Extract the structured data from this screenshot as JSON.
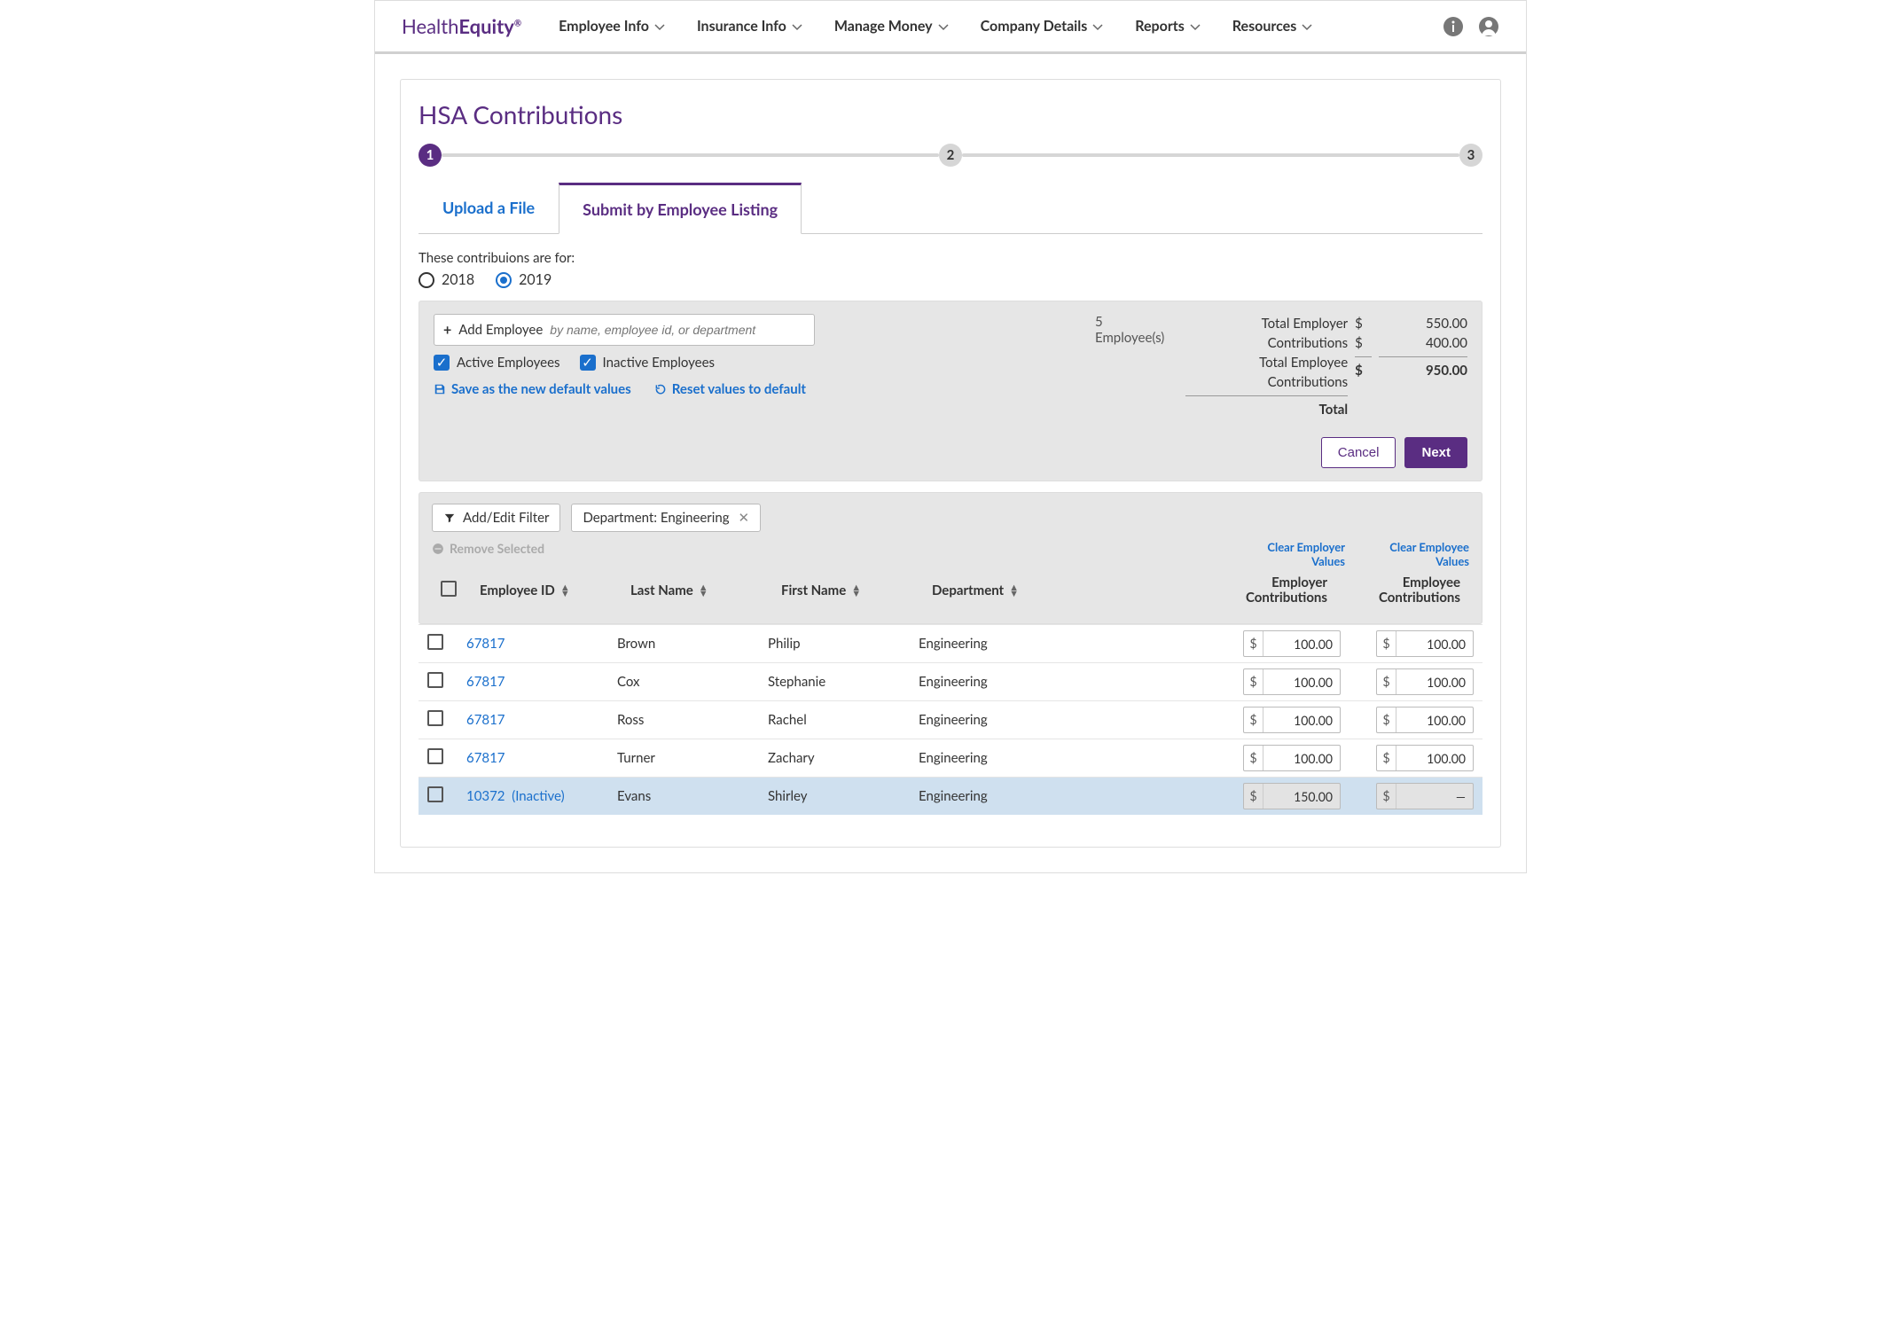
{
  "brand": {
    "word1": "Health",
    "word2": "Equity"
  },
  "nav": {
    "items": [
      "Employee Info",
      "Insurance Info",
      "Manage Money",
      "Company Details",
      "Reports",
      "Resources"
    ]
  },
  "page": {
    "title": "HSA Contributions"
  },
  "stepper": {
    "s1": "1",
    "s2": "2",
    "s3": "3"
  },
  "tabs": {
    "upload": "Upload a File",
    "listing": "Submit by Employee Listing"
  },
  "yearSection": {
    "label": "These contribuions are for:",
    "y1": "2018",
    "y2": "2019"
  },
  "addEmp": {
    "plus": "+",
    "label": "Add Employee",
    "placeholder": "by name, employee id, or department"
  },
  "checks": {
    "active": "Active Employees",
    "inactive": "Inactive Employees"
  },
  "links": {
    "save": "Save as the new default values",
    "reset": "Reset values to default"
  },
  "summary": {
    "count": "5 Employee(s)",
    "l1": "Total Employer Contributions",
    "l2": "Total Employee Contributions",
    "l3": "Total",
    "v1": "550.00",
    "v2": "400.00",
    "v3": "950.00",
    "dollar": "$"
  },
  "buttons": {
    "cancel": "Cancel",
    "next": "Next"
  },
  "filter": {
    "addEdit": "Add/Edit Filter",
    "chip": "Department: Engineering",
    "remove": "Remove Selected",
    "clearEmp": "Clear Employer Values",
    "clearEe": "Clear Employee Values"
  },
  "thead": {
    "id": "Employee ID",
    "ln": "Last Name",
    "fn": "First Name",
    "dep": "Department",
    "emp1": "Employer",
    "emp2": "Contributions",
    "ee1": "Employee",
    "ee2": "Contributions"
  },
  "rows": [
    {
      "id": "67817",
      "ln": "Brown",
      "fn": "Philip",
      "dep": "Engineering",
      "emp": "100.00",
      "ee": "100.00",
      "inactive": false
    },
    {
      "id": "67817",
      "ln": "Cox",
      "fn": "Stephanie",
      "dep": "Engineering",
      "emp": "100.00",
      "ee": "100.00",
      "inactive": false
    },
    {
      "id": "67817",
      "ln": "Ross",
      "fn": "Rachel",
      "dep": "Engineering",
      "emp": "100.00",
      "ee": "100.00",
      "inactive": false
    },
    {
      "id": "67817",
      "ln": "Turner",
      "fn": "Zachary",
      "dep": "Engineering",
      "emp": "100.00",
      "ee": "100.00",
      "inactive": false
    },
    {
      "id": "10372",
      "ln": "Evans",
      "fn": "Shirley",
      "dep": "Engineering",
      "emp": "150.00",
      "ee": "—",
      "inactive": true,
      "tag": "(Inactive)"
    }
  ]
}
